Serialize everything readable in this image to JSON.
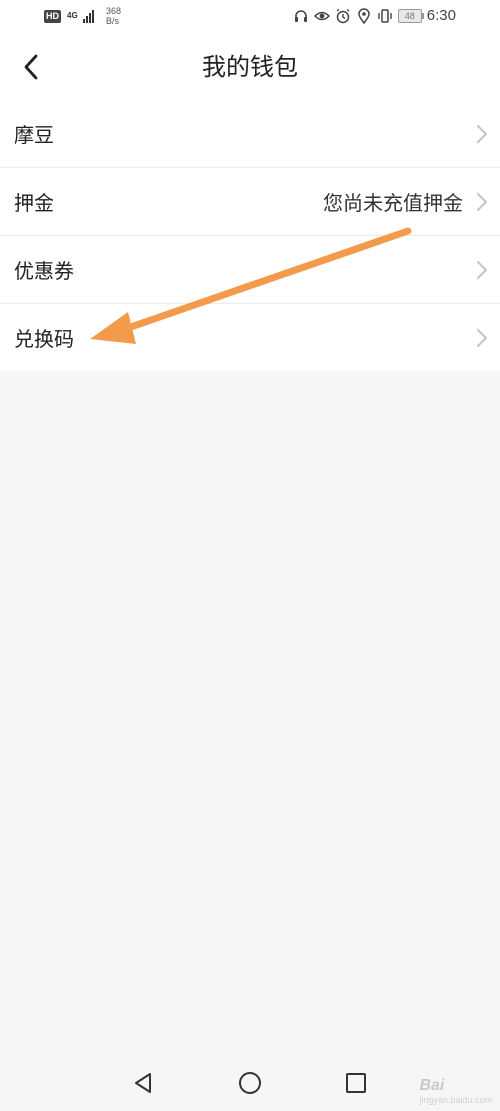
{
  "status_bar": {
    "hd_badge": "HD",
    "network_type": "4G",
    "net_speed_value": "368",
    "net_speed_unit": "B/s",
    "battery_level": "48",
    "time": "6:30",
    "icons": [
      "headphones-icon",
      "eye-icon",
      "alarm-icon",
      "location-icon",
      "vibrate-icon",
      "battery-icon"
    ]
  },
  "header": {
    "title": "我的钱包",
    "back_icon": "chevron-left-icon"
  },
  "wallet_items": [
    {
      "label": "摩豆",
      "value": ""
    },
    {
      "label": "押金",
      "value": "您尚未充值押金"
    },
    {
      "label": "优惠券",
      "value": ""
    },
    {
      "label": "兑换码",
      "value": ""
    }
  ],
  "annotation": {
    "color": "#f39a4b",
    "points_to": "兑换码"
  },
  "nav_bar": {
    "icons": [
      "back-triangle-icon",
      "home-circle-icon",
      "recents-square-icon"
    ]
  },
  "watermark": {
    "text": "Bai",
    "sub_text": "jingyan.baidu.com"
  },
  "colors": {
    "background": "#f6f6f6",
    "surface": "#ffffff",
    "divider": "#ececec",
    "text_primary": "#222222",
    "chevron": "#c4c4c4"
  }
}
